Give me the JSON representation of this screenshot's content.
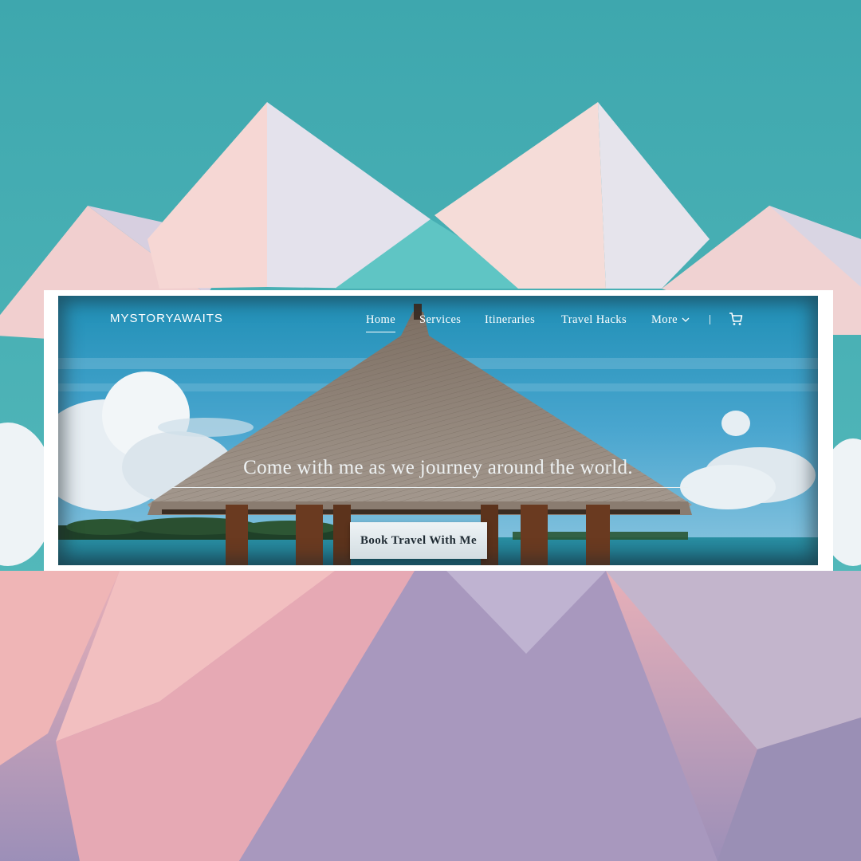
{
  "site": {
    "brand": "MYSTORYAWAITS"
  },
  "nav": {
    "items": [
      {
        "label": "Home",
        "active": true
      },
      {
        "label": "Services"
      },
      {
        "label": "Itineraries"
      },
      {
        "label": "Travel Hacks"
      },
      {
        "label": "More"
      }
    ],
    "cart_icon": "cart-icon",
    "more_icon": "chevron-down-icon"
  },
  "hero": {
    "tagline": "Come with me as we journey around the world.",
    "cta_label": "Book Travel With Me"
  },
  "colors": {
    "backdrop_sky": "#4fb0b3",
    "frame": "#ffffff",
    "cta_text": "#1f2b33"
  }
}
